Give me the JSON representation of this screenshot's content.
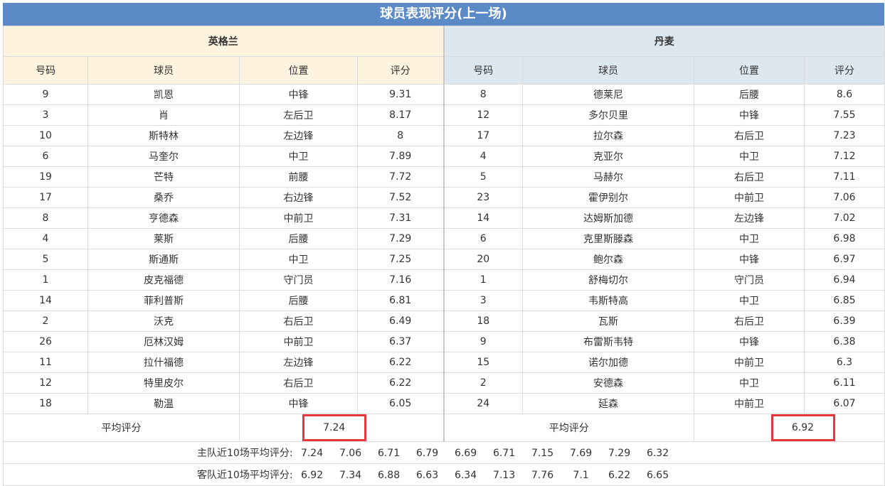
{
  "title": "球员表现评分(上一场)",
  "home": {
    "name": "英格兰",
    "headers": [
      "号码",
      "球员",
      "位置",
      "评分"
    ],
    "players": [
      [
        "9",
        "凯恩",
        "中锋",
        "9.31"
      ],
      [
        "3",
        "肖",
        "左后卫",
        "8.17"
      ],
      [
        "10",
        "斯特林",
        "左边锋",
        "8"
      ],
      [
        "6",
        "马奎尔",
        "中卫",
        "7.89"
      ],
      [
        "19",
        "芒特",
        "前腰",
        "7.72"
      ],
      [
        "17",
        "桑乔",
        "右边锋",
        "7.52"
      ],
      [
        "8",
        "亨德森",
        "中前卫",
        "7.31"
      ],
      [
        "4",
        "莱斯",
        "后腰",
        "7.29"
      ],
      [
        "5",
        "斯通斯",
        "中卫",
        "7.25"
      ],
      [
        "1",
        "皮克福德",
        "守门员",
        "7.16"
      ],
      [
        "14",
        "菲利普斯",
        "后腰",
        "6.81"
      ],
      [
        "2",
        "沃克",
        "右后卫",
        "6.49"
      ],
      [
        "26",
        "厄林汉姆",
        "中前卫",
        "6.37"
      ],
      [
        "11",
        "拉什福德",
        "左边锋",
        "6.22"
      ],
      [
        "12",
        "特里皮尔",
        "右后卫",
        "6.22"
      ],
      [
        "18",
        "勒温",
        "中锋",
        "6.05"
      ]
    ],
    "avg_label": "平均评分",
    "avg_value": "7.24"
  },
  "away": {
    "name": "丹麦",
    "headers": [
      "号码",
      "球员",
      "位置",
      "评分"
    ],
    "players": [
      [
        "8",
        "德莱尼",
        "后腰",
        "8.6"
      ],
      [
        "12",
        "多尔贝里",
        "中锋",
        "7.55"
      ],
      [
        "17",
        "拉尔森",
        "右后卫",
        "7.23"
      ],
      [
        "4",
        "克亚尔",
        "中卫",
        "7.12"
      ],
      [
        "5",
        "马赫尔",
        "右后卫",
        "7.11"
      ],
      [
        "23",
        "霍伊别尔",
        "中前卫",
        "7.06"
      ],
      [
        "14",
        "达姆斯加德",
        "左边锋",
        "7.02"
      ],
      [
        "6",
        "克里斯滕森",
        "中卫",
        "6.98"
      ],
      [
        "20",
        "鲍尔森",
        "中锋",
        "6.97"
      ],
      [
        "1",
        "舒梅切尔",
        "守门员",
        "6.94"
      ],
      [
        "3",
        "韦斯特高",
        "中卫",
        "6.85"
      ],
      [
        "18",
        "瓦斯",
        "右后卫",
        "6.39"
      ],
      [
        "9",
        "布雷斯韦特",
        "中锋",
        "6.38"
      ],
      [
        "15",
        "诺尔加德",
        "中前卫",
        "6.3"
      ],
      [
        "2",
        "安德森",
        "中卫",
        "6.11"
      ],
      [
        "24",
        "延森",
        "中前卫",
        "6.07"
      ]
    ],
    "avg_label": "平均评分",
    "avg_value": "6.92"
  },
  "recent_home": {
    "label": "主队近10场平均评分:",
    "values": [
      "7.24",
      "7.06",
      "6.71",
      "6.79",
      "6.69",
      "6.71",
      "7.15",
      "7.69",
      "7.29",
      "6.32"
    ]
  },
  "recent_away": {
    "label": "客队近10场平均评分:",
    "values": [
      "6.92",
      "7.34",
      "6.88",
      "6.63",
      "6.34",
      "7.13",
      "7.76",
      "7.1",
      "6.22",
      "6.65"
    ]
  },
  "colors": {
    "title_bg": "#5b8ac6",
    "home_header_bg": "#fdf3df",
    "away_header_bg": "#dde7f0",
    "highlight_border": "#e8373e"
  }
}
